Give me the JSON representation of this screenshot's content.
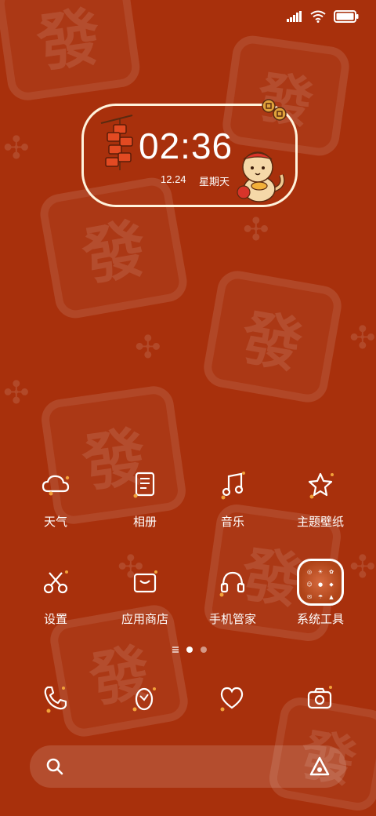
{
  "clock": {
    "time": "02:36",
    "date": "12.24",
    "weekday": "星期天"
  },
  "background": {
    "tile_glyph": "發"
  },
  "apps": [
    {
      "label": "天气",
      "icon": "cloud-icon"
    },
    {
      "label": "相册",
      "icon": "document-icon"
    },
    {
      "label": "音乐",
      "icon": "music-note-icon"
    },
    {
      "label": "主题壁纸",
      "icon": "star-icon"
    },
    {
      "label": "设置",
      "icon": "scissors-icon"
    },
    {
      "label": "应用商店",
      "icon": "store-bag-icon"
    },
    {
      "label": "手机管家",
      "icon": "headphones-icon"
    },
    {
      "label": "系统工具",
      "icon": "folder-icon"
    }
  ],
  "dock": [
    {
      "icon": "phone-icon"
    },
    {
      "icon": "egg-browser-icon"
    },
    {
      "icon": "heart-icon"
    },
    {
      "icon": "camera-icon"
    }
  ],
  "pager": {
    "current_page": 1,
    "page_count": 2
  },
  "colors": {
    "background": "#a8300c",
    "widget_border": "#fff3dc",
    "accent_orange": "#f2a23a"
  }
}
